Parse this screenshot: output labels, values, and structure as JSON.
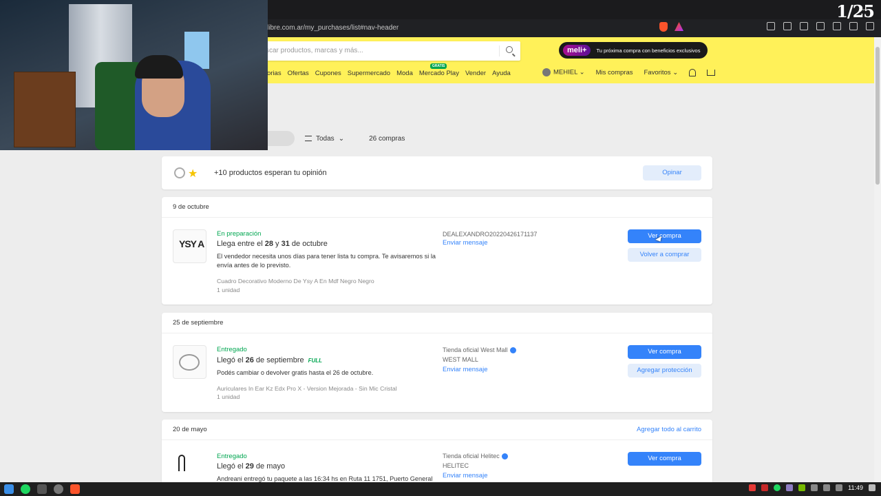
{
  "browser": {
    "url": "libre.com.ar/my_purchases/list#nav-header",
    "counter": "1/25"
  },
  "header": {
    "search_placeholder": "scar productos, marcas y más...",
    "meli_logo": "meli+",
    "meli_text": "Tu próxima compra con beneficios exclusivos",
    "nav": [
      "orias",
      "Ofertas",
      "Cupones",
      "Supermercado",
      "Moda",
      "Mercado Play",
      "Vender",
      "Ayuda"
    ],
    "gratis_badge": "GRATIS",
    "user": "MEHIEL",
    "my_purchases": "Mis compras",
    "favorites": "Favoritos"
  },
  "filters": {
    "label": "Todas",
    "count": "26 compras"
  },
  "opinion": {
    "text": "+10 productos esperan tu opinión",
    "button": "Opinar"
  },
  "orders": [
    {
      "date": "9 de octubre",
      "status": "En preparación",
      "headline_pre": "Llega entre el ",
      "headline_b1": "28",
      "headline_mid": " y ",
      "headline_b2": "31",
      "headline_post": " de octubre",
      "desc": "El vendedor necesita unos días para tener lista tu compra. Te avisaremos si la envía antes de lo previsto.",
      "product": "Cuadro Decorativo Moderno De Ysy A En Mdf Negro Negro",
      "units": "1 unidad",
      "seller": "DEALEXANDRO20220426171137",
      "message": "Enviar mensaje",
      "primary": "Ver compra",
      "secondary": "Volver a comprar",
      "thumb_text": "YSY A"
    },
    {
      "date": "25 de septiembre",
      "status": "Entregado",
      "headline_pre": "Llegó el ",
      "headline_b1": "26",
      "headline_post": " de septiembre",
      "full": "FULL",
      "desc": "Podés cambiar o devolver gratis hasta el 26 de octubre.",
      "product": "Auriculares In Ear Kz Edx Pro X - Version Mejorada - Sin Mic Cristal",
      "units": "1 unidad",
      "seller": "Tienda oficial West Mall",
      "seller2": "WEST MALL",
      "message": "Enviar mensaje",
      "primary": "Ver compra",
      "secondary": "Agregar protección"
    },
    {
      "date": "20 de mayo",
      "add_all": "Agregar todo al carrito",
      "status": "Entregado",
      "headline_pre": "Llegó el ",
      "headline_b1": "29",
      "headline_post": " de mayo",
      "desc": "Andreani entregó tu paquete a las 16:34 hs en Ruta 11 1751, Puerto General",
      "seller": "Tienda oficial Helitec",
      "seller2": "HELITEC",
      "message": "Enviar mensaje",
      "primary": "Ver compra"
    }
  ],
  "taskbar": {
    "time": "11:49"
  }
}
